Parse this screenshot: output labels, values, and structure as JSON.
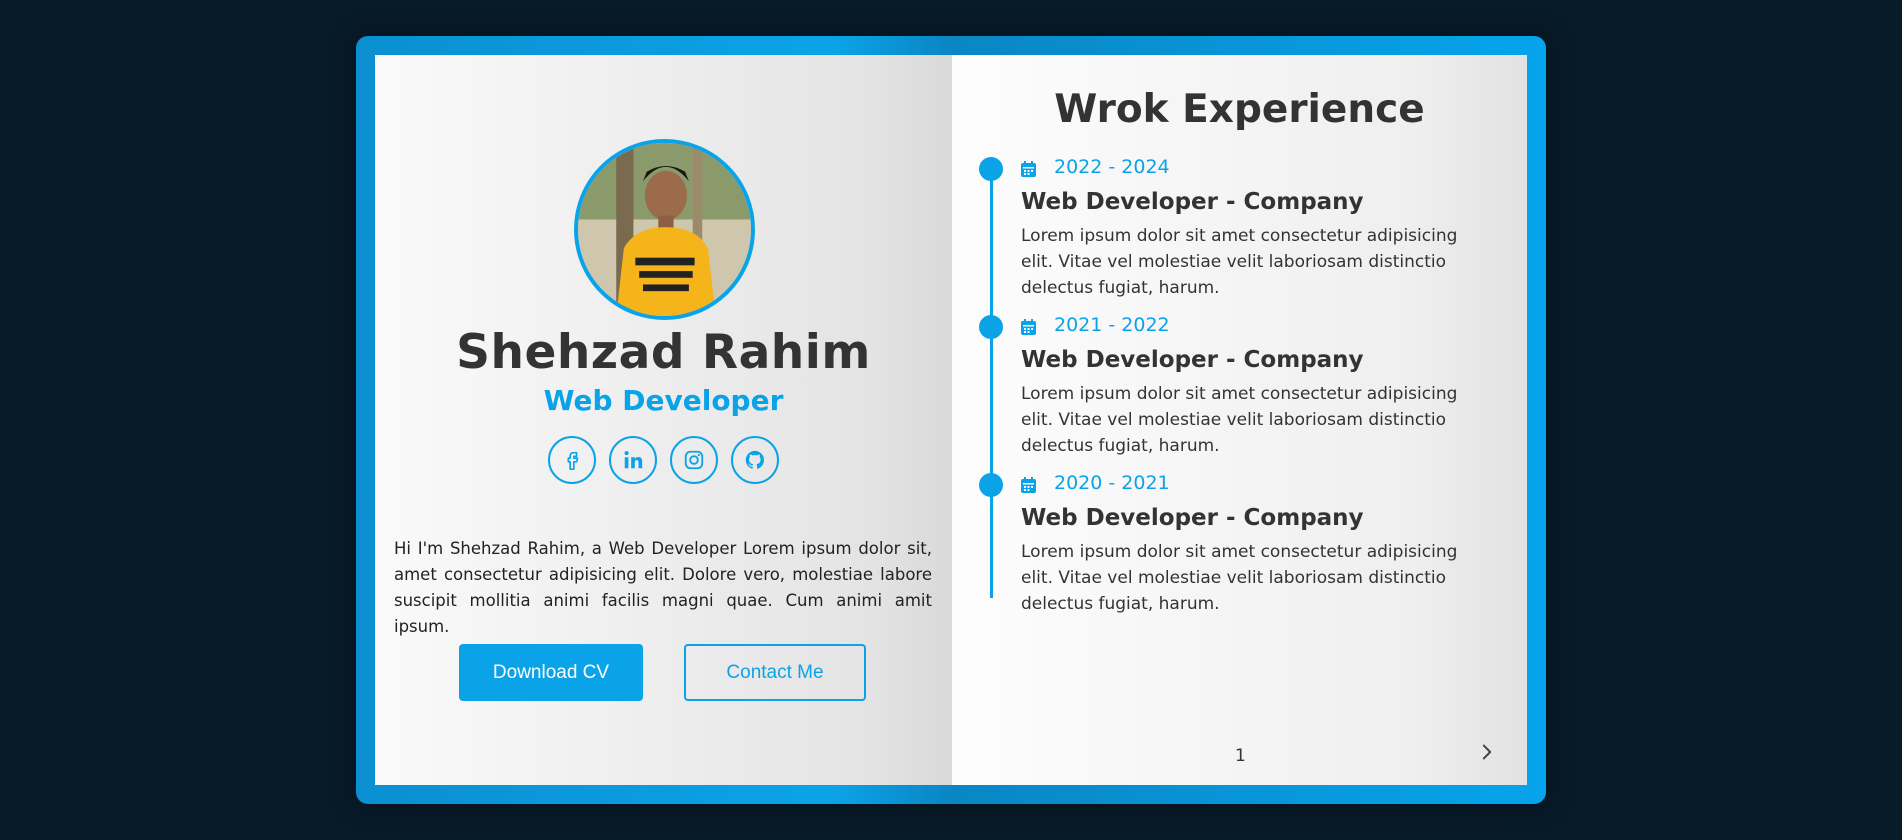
{
  "profile": {
    "name": "Shehzad Rahim",
    "role": "Web Developer",
    "bio": "Hi I'm Shehzad Rahim, a Web Developer Lorem ipsum dolor sit, amet consectetur adipisicing elit. Dolore vero, molestiae labore suscipit mollitia animi facilis magni quae. Cum animi amit ipsum.",
    "avatar_alt": "profile-photo"
  },
  "socials": [
    {
      "icon": "facebook-icon"
    },
    {
      "icon": "linkedin-icon"
    },
    {
      "icon": "instagram-icon"
    },
    {
      "icon": "github-icon"
    }
  ],
  "actions": {
    "download_label": "Download CV",
    "contact_label": "Contact Me"
  },
  "experience": {
    "title": "Wrok Experience",
    "items": [
      {
        "date": "2022 - 2024",
        "job": "Web Developer - Company",
        "desc": "Lorem ipsum dolor sit amet consectetur adipisicing elit. Vitae vel molestiae velit laboriosam distinctio delectus fugiat, harum."
      },
      {
        "date": "2021 - 2022",
        "job": "Web Developer - Company",
        "desc": "Lorem ipsum dolor sit amet consectetur adipisicing elit. Vitae vel molestiae velit laboriosam distinctio delectus fugiat, harum."
      },
      {
        "date": "2020 - 2021",
        "job": "Web Developer - Company",
        "desc": "Lorem ipsum dolor sit amet consectetur adipisicing elit. Vitae vel molestiae velit laboriosam distinctio delectus fugiat, harum."
      }
    ]
  },
  "pagination": {
    "page_number": "1",
    "next_icon": "chevron-right-icon"
  },
  "colors": {
    "accent": "#0ba3e8",
    "background": "#081b29",
    "text": "#333333"
  }
}
